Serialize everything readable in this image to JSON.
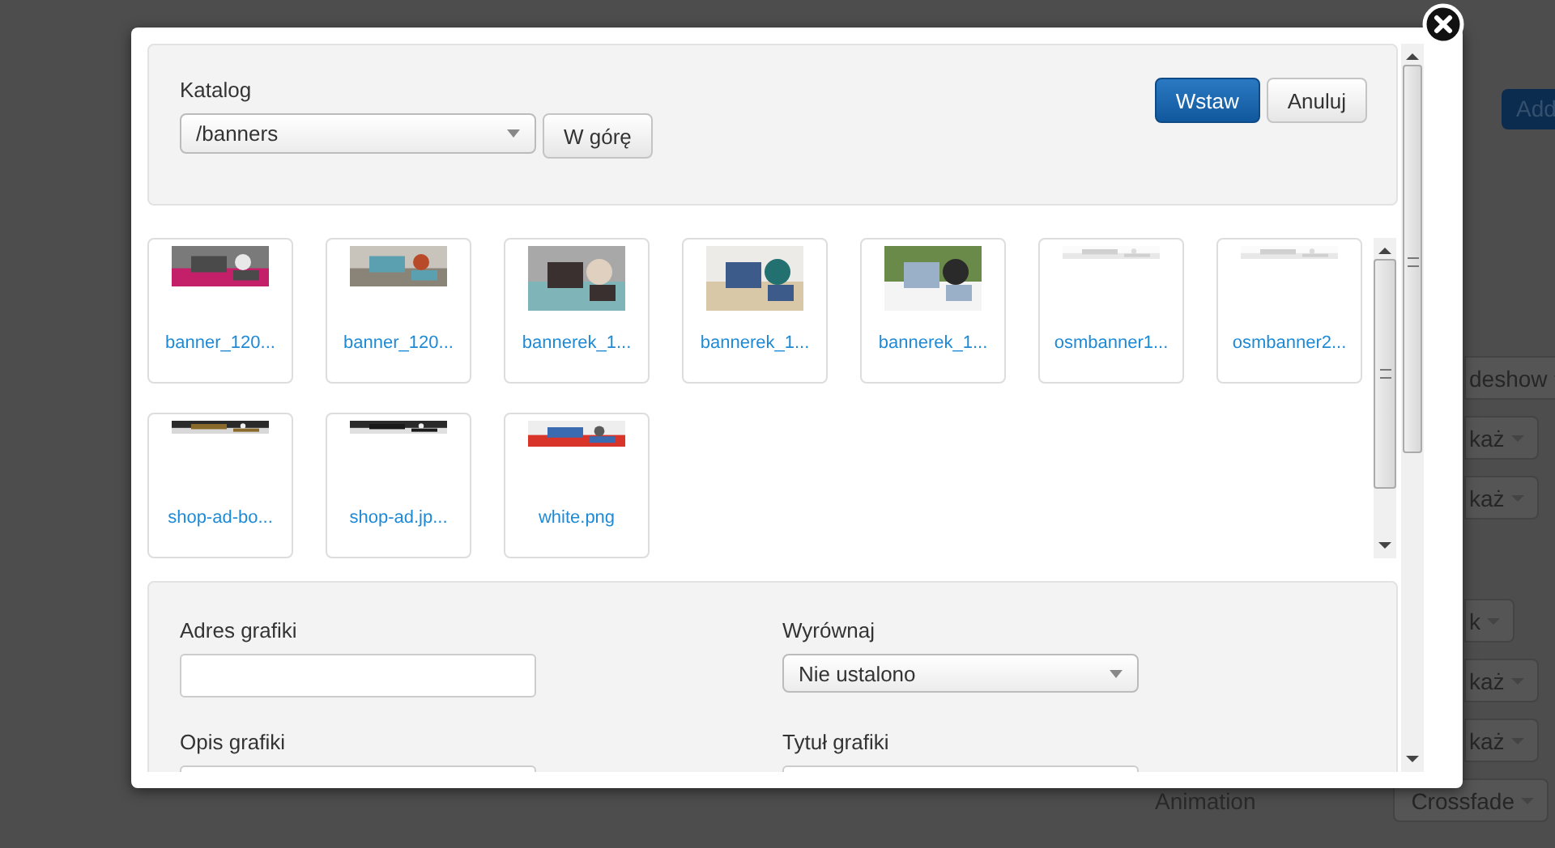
{
  "background": {
    "items": [
      {
        "kind": "button",
        "label": "Add"
      },
      {
        "kind": "dropdown",
        "value": "deshow"
      },
      {
        "kind": "dropdown",
        "value": "każ"
      },
      {
        "kind": "dropdown",
        "value": "każ"
      },
      {
        "kind": "dropdown",
        "value": "k"
      },
      {
        "kind": "dropdown",
        "value": "każ"
      },
      {
        "kind": "dropdown",
        "value": "każ"
      },
      {
        "kind": "labeled-dropdown",
        "label": "Animation",
        "value": "Crossfade"
      }
    ]
  },
  "dialog": {
    "directory": {
      "label": "Katalog",
      "value": "/banners",
      "up_button": "W górę"
    },
    "buttons": [
      {
        "label": "Wstaw",
        "primary": true
      },
      {
        "label": "Anuluj",
        "primary": false
      }
    ],
    "files": [
      {
        "name": "banner_120...",
        "kind": "picture"
      },
      {
        "name": "banner_120...",
        "kind": "picture"
      },
      {
        "name": "bannerek_1...",
        "kind": "picture"
      },
      {
        "name": "bannerek_1...",
        "kind": "picture"
      },
      {
        "name": "bannerek_1...",
        "kind": "picture"
      },
      {
        "name": "osmbanner1...",
        "kind": "picture"
      },
      {
        "name": "osmbanner2...",
        "kind": "picture"
      },
      {
        "name": "shop-ad-bo...",
        "kind": "picture"
      },
      {
        "name": "shop-ad.jp...",
        "kind": "picture"
      },
      {
        "name": "white.png",
        "kind": "picture"
      }
    ],
    "fields": [
      {
        "kind": "text",
        "label": "Adres grafiki"
      },
      {
        "kind": "select",
        "label": "Wyrównaj",
        "value": "Nie ustalono"
      },
      {
        "kind": "text",
        "label": "Opis grafiki"
      },
      {
        "kind": "text",
        "label": "Tytuł grafiki"
      }
    ]
  }
}
